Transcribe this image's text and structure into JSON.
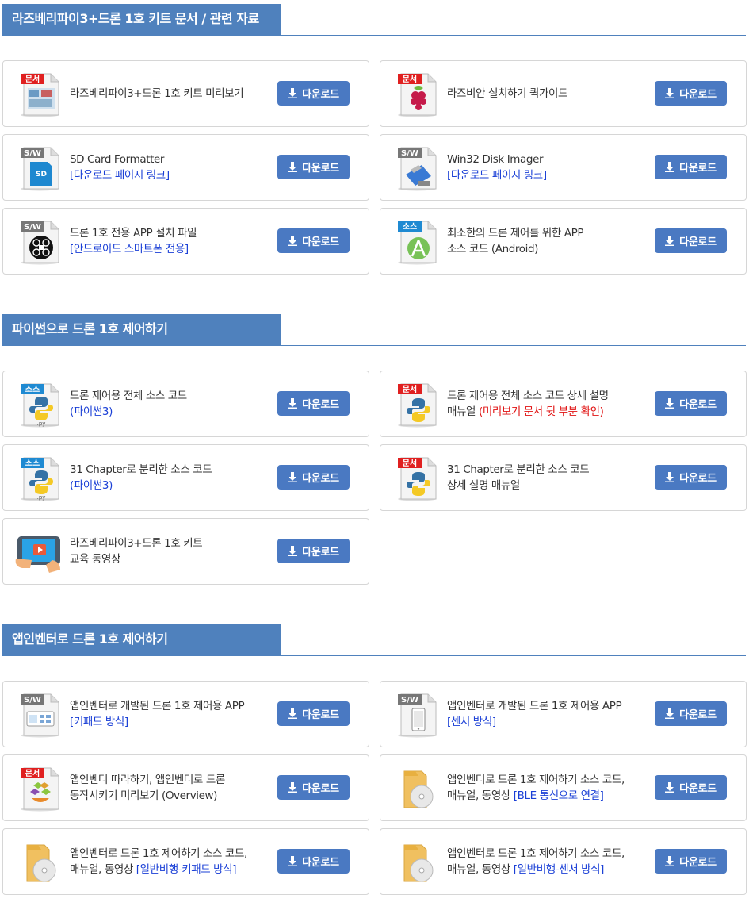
{
  "colors": {
    "accent": "#4f81bd",
    "button": "#4a79c2",
    "link_blue": "#1a3fd6",
    "warn_red": "#e01010"
  },
  "download_label": "다운로드",
  "sections": [
    {
      "title": "라즈베리파이3+드론 1호 키트 문서 / 관련 자료",
      "items": [
        {
          "icon": "doc-image-icon",
          "badge": "문서",
          "line1": "라즈베리파이3+드론 1호 키트 미리보기",
          "line2": ""
        },
        {
          "icon": "raspberry-pi-icon",
          "badge": "문서",
          "line1": "라즈비안 설치하기 퀵가이드",
          "line2": ""
        },
        {
          "icon": "sd-card-icon",
          "badge": "S/W",
          "line1": "SD Card Formatter",
          "line2": "[다운로드 페이지 링크]"
        },
        {
          "icon": "usb-disk-icon",
          "badge": "S/W",
          "line1": "Win32 Disk Imager",
          "line2": "[다운로드 페이지 링크]"
        },
        {
          "icon": "drone-app-icon",
          "badge": "S/W",
          "line1": "드론 1호 전용 APP 설치 파일",
          "line2": "[안드로이드 스마트폰 전용]"
        },
        {
          "icon": "android-studio-icon",
          "badge": "소스",
          "line1": "최소한의 드론 제어를 위한 APP",
          "line2": "소스 코드 (Android)"
        }
      ]
    },
    {
      "title": "파이썬으로 드론 1호 제어하기",
      "items": [
        {
          "icon": "python-file-icon",
          "badge": "소스",
          "line1": "드론 제어용 전체 소스 코드",
          "line2": "(파이썬3)"
        },
        {
          "icon": "python-doc-icon",
          "badge": "문서",
          "line1": "드론 제어용 전체 소스 코드 상세 설명",
          "line2_prefix": "매뉴얼 ",
          "line2": "(미리보기 문서 뒷 부분 확인)"
        },
        {
          "icon": "python-file-icon",
          "badge": "소스",
          "line1": "31 Chapter로 분리한 소스 코드",
          "line2": "(파이썬3)"
        },
        {
          "icon": "python-doc-icon",
          "badge": "문서",
          "line1": "31 Chapter로 분리한 소스 코드",
          "line2": "상세 설명 매뉴얼"
        },
        {
          "icon": "video-tablet-icon",
          "badge": "",
          "line1": "라즈베리파이3+드론 1호 키트",
          "line2": "교육 동영상"
        }
      ]
    },
    {
      "title": "앱인벤터로 드론 1호 제어하기",
      "items": [
        {
          "icon": "keypad-app-icon",
          "badge": "S/W",
          "line1": "앱인벤터로 개발된 드론 1호 제어용 APP",
          "line2": "[키패드 방식]"
        },
        {
          "icon": "phone-app-icon",
          "badge": "S/W",
          "line1": "앱인벤터로 개발된 드론 1호 제어용 APP",
          "line2": "[센서 방식]"
        },
        {
          "icon": "app-inventor-doc-icon",
          "badge": "문서",
          "line1": "앱인벤터 따라하기, 앱인벤터로 드론",
          "line2": "동작시키기 미리보기 (Overview)"
        },
        {
          "icon": "folder-disc-icon",
          "badge": "",
          "line1": "앱인벤터로 드론 1호 제어하기 소스 코드,",
          "line2_prefix": "매뉴얼, 동영상 ",
          "line2": "[BLE 통신으로 연결]"
        },
        {
          "icon": "folder-disc-icon",
          "badge": "",
          "line1": "앱인벤터로 드론 1호 제어하기 소스 코드,",
          "line2_prefix": "매뉴얼, 동영상 ",
          "line2": "[일반비행-키패드 방식]"
        },
        {
          "icon": "folder-disc-icon",
          "badge": "",
          "line1": "앱인벤터로 드론 1호 제어하기 소스 코드,",
          "line2_prefix": "매뉴얼, 동영상 ",
          "line2": "[일반비행-센서 방식]"
        }
      ]
    }
  ]
}
